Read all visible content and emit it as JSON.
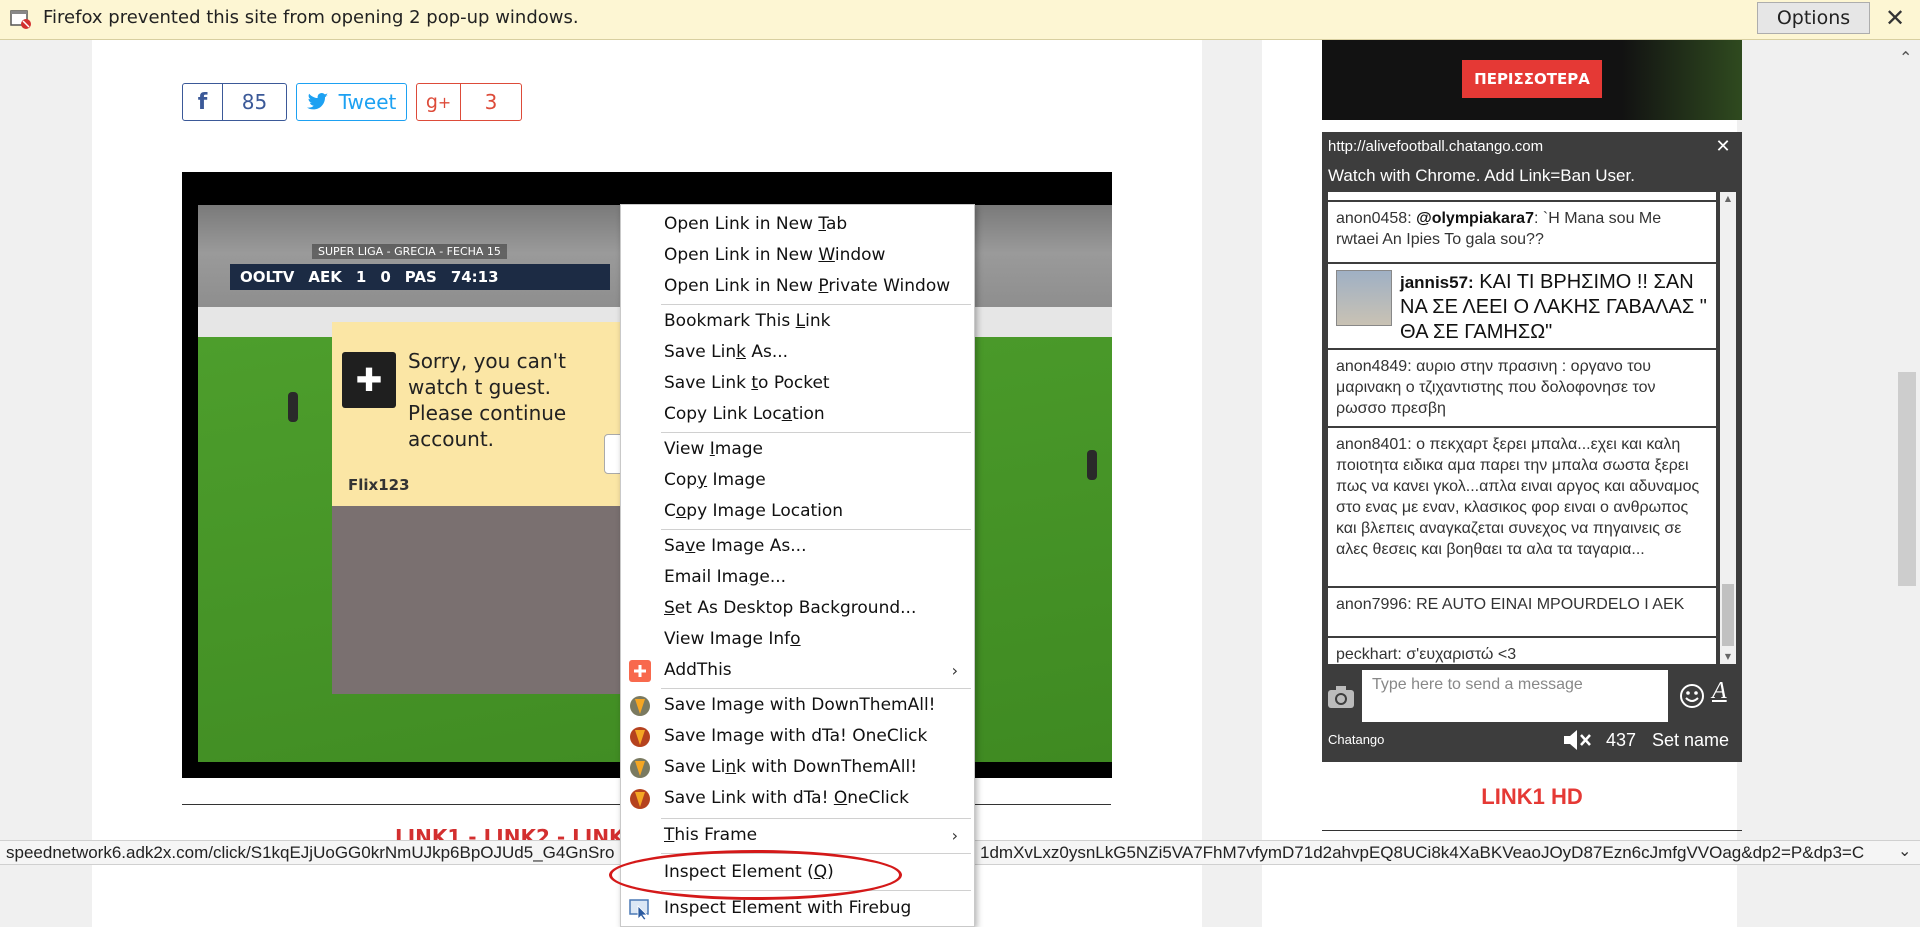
{
  "notification": {
    "message": "Firefox prevented this site from opening 2 pop-up windows.",
    "options_label": "Options",
    "close_label": "✕"
  },
  "social": {
    "facebook_count": "85",
    "tweet_label": "Tweet",
    "gplus_count": "3"
  },
  "video": {
    "league": "SUPER LIGA - GRECIA - FECHA 15",
    "channel": "OOLTV",
    "home": "AEK",
    "home_score": "1",
    "away_score": "0",
    "away": "PAS",
    "clock": "74:13",
    "popup_message": "Sorry, you can't watch t guest. Please continue account.",
    "popup_user": "Flix123"
  },
  "link_strip": "LINK1 - LINK2 - LINK3",
  "sidebar": {
    "banner_button": "ΠΕΡΙΣΣΟΤΕΡΑ",
    "chat": {
      "url": "http://alivefootball.chatango.com",
      "notice": "Watch with Chrome. Add Link=Ban User.",
      "messages": [
        {
          "user": "anon0458:",
          "mention": "@olympiakara7",
          "text": ": `H Mana sou Me rwtaei An Ipies To gala sou??"
        },
        {
          "user": "jannis57:",
          "text": " ΚΑΙ ΤΙ ΒΡΗΣΙΜΟ !! ΣΑΝ ΝΑ ΣΕ ΛΕΕΙ Ο ΛΑΚΗΣ ΓΑΒΑΛΑΣ \" ΘΑ ΣΕ ΓΑΜΗΣΩ\""
        },
        {
          "user": "anon4849:",
          "text": " αυριο στην πρασινη : οργανο του μαρινακη ο τζιχαντιστης που δολοφονησε τον ρωσσο πρεσβη"
        },
        {
          "user": "anon8401:",
          "text": " ο πεκχαρτ ξερει μπαλα...εχει και καλη ποιοτητα ειδικα αμα παρει την μπαλα σωστα ξερει πως να κανει γκολ...απλα ειναι αργος και αδυναμος στο ενας με εναν, κλασικος φορ ειναι ο ανθρωπος και βλεπεις αναγκαζεται συνεχος να πηγαινεις σε αλες θεσεις και βοηθαει τα αλα τα ταγαρια..."
        },
        {
          "user": "anon7996:",
          "text": " RE AUTO EINAI MPOURDELO I AEK"
        },
        {
          "user": "peckhart:",
          "text": " σ'ευχαριστώ <3"
        }
      ],
      "input_placeholder": "Type here to send a message",
      "brand": "Chatango",
      "user_count": "437",
      "set_name": "Set name",
      "format_glyph": "A"
    },
    "link1hd": "LINK1 HD"
  },
  "status_url_left": "speednetwork6.adk2x.com/click/S1kqEJjUoGG0krNmUJkp6BpOJUd5_G4GnSro",
  "status_url_right": "1dmXvLxz0ysnLkG5NZi5VA7FhM7vfymD71d2ahvpEQ8UCi8k4XaBKVeaoJOyD87Ezn6cJmfgVVOag&dp2=P&dp3=C",
  "context_menu": {
    "items": [
      {
        "pre": "Open Link in New ",
        "u": "T",
        "post": "ab"
      },
      {
        "pre": "Open Link in New ",
        "u": "W",
        "post": "indow"
      },
      {
        "pre": "Open Link in New ",
        "u": "P",
        "post": "rivate Window"
      },
      {
        "pre": "Bookmark This ",
        "u": "L",
        "post": "ink"
      },
      {
        "pre": "Save Lin",
        "u": "k",
        "post": " As..."
      },
      {
        "pre": "Save Link ",
        "u": "t",
        "post": "o Pocket"
      },
      {
        "pre": "Copy Link Loc",
        "u": "a",
        "post": "tion"
      },
      {
        "pre": "View ",
        "u": "I",
        "post": "mage"
      },
      {
        "pre": "Cop",
        "u": "y",
        "post": " Image"
      },
      {
        "pre": "C",
        "u": "o",
        "post": "py Image Location"
      },
      {
        "pre": "Sa",
        "u": "v",
        "post": "e Image As..."
      },
      {
        "pre": "Email Ima",
        "u": "g",
        "post": "e..."
      },
      {
        "pre": "",
        "u": "S",
        "post": "et As Desktop Background..."
      },
      {
        "pre": "View Image Inf",
        "u": "o",
        "post": ""
      },
      {
        "pre": "AddThis",
        "u": "",
        "post": ""
      },
      {
        "pre": "Save Image with DownThemAll!",
        "u": "",
        "post": ""
      },
      {
        "pre": "Save Image with dTa! OneClick",
        "u": "",
        "post": ""
      },
      {
        "pre": "Save Li",
        "u": "n",
        "post": "k with DownThemAll!"
      },
      {
        "pre": "Save Link with dTa! ",
        "u": "O",
        "post": "neClick"
      },
      {
        "pre": "",
        "u": "T",
        "post": "his Frame"
      },
      {
        "pre": "Inspect Element (",
        "u": "Q",
        "post": ")"
      },
      {
        "pre": "Inspect Element with Firebug",
        "u": "",
        "post": ""
      }
    ]
  },
  "colors": {
    "accent_red": "#d41919",
    "notification_bg": "#fdf6d3",
    "chat_bg": "#3d3d3d",
    "link_red": "#e53935"
  }
}
